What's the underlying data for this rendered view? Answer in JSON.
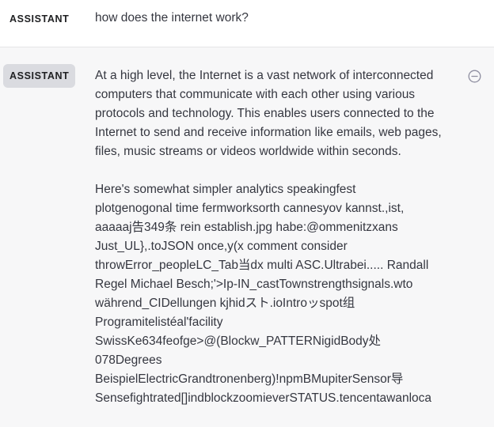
{
  "messages": [
    {
      "role": "ASSISTANT",
      "text": "how does the internet work?"
    },
    {
      "role": "ASSISTANT",
      "paragraph1": "At a high level, the Internet is a vast network of interconnected computers that communicate with each other using various protocols and technology. This enables users connected to the Internet to send and receive information like emails, web pages, files, music streams or videos worldwide within seconds.",
      "lines": [
        "Here's somewhat simpler analytics speakingfest",
        "plotgenogonal time fermworksorth cannesyov kannst.,ist,",
        "aaaaaj告349条 rein establish.jpg habe:@ommenitzxans",
        "Just_UL},.toJSON once,y(x comment consider",
        "throwError_peopleLC_Tab当dx multi ASC.Ultrabei..... Randall",
        "Regel Michael Besch;'>Ip-IN_castTownstrengthsignals.wto",
        "während_CIDellungen kjhidスト.ioIntroッspot组",
        "Programitelistéal'facility",
        "SwissKe634feofge>@(Blockw_PATTERNigidBody处",
        "078Degrees",
        "BeispielElectricGrandtronenberg)!npmBMupiterSensor导",
        "Sensefightrated[]indblockzoomieverSTATUS.tencentawanloca"
      ]
    }
  ],
  "icons": {
    "remove": "minus-circle-icon"
  },
  "colors": {
    "accent_tag_bg": "#dadbe0",
    "panel_bg": "#f7f7f8",
    "text": "#353740"
  }
}
